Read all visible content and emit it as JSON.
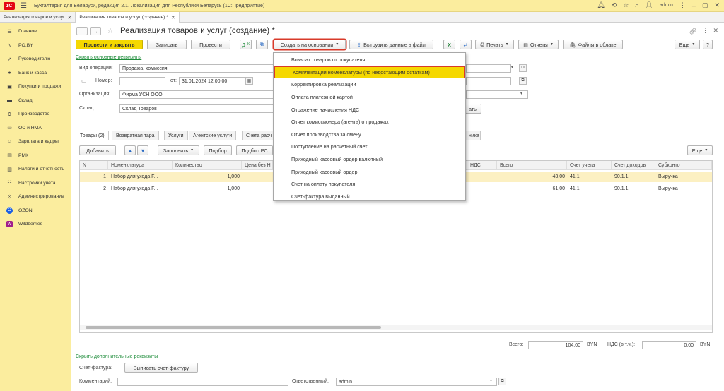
{
  "app": {
    "logo": "1С",
    "title": "Бухгалтерия для Беларуси, редакция 2.1. Локализация для Республики Беларусь   (1С:Предприятие)",
    "user": "admin",
    "accent": "#fbed9e",
    "primary_button_color": "#f5d800",
    "highlight_color": "#d83a2a"
  },
  "tabs": [
    {
      "label": "Реализация товаров и услуг",
      "active": false
    },
    {
      "label": "Реализация товаров и услуг (создание) *",
      "active": true
    }
  ],
  "sidebar": {
    "items": [
      {
        "label": "Главное",
        "icon": "menu-icon"
      },
      {
        "label": "PO.BY",
        "icon": "tilde-icon"
      },
      {
        "label": "Руководителю",
        "icon": "chart-icon"
      },
      {
        "label": "Банк и касса",
        "icon": "bank-icon"
      },
      {
        "label": "Покупки и продажи",
        "icon": "cart-icon"
      },
      {
        "label": "Склад",
        "icon": "warehouse-icon"
      },
      {
        "label": "Производство",
        "icon": "factory-icon"
      },
      {
        "label": "ОС и НМА",
        "icon": "assets-icon"
      },
      {
        "label": "Зарплата и кадры",
        "icon": "people-icon"
      },
      {
        "label": "РМК",
        "icon": "register-icon"
      },
      {
        "label": "Налоги и отчетность",
        "icon": "tax-icon"
      },
      {
        "label": "Настройки учета",
        "icon": "settings-icon"
      },
      {
        "label": "Администрирование",
        "icon": "gear-icon"
      },
      {
        "label": "OZON",
        "icon": "ozon-icon"
      },
      {
        "label": "Wildberries",
        "icon": "wildberries-icon"
      }
    ]
  },
  "document": {
    "title": "Реализация товаров и услуг (создание) *"
  },
  "toolbar": {
    "post_close": "Провести и закрыть",
    "save": "Записать",
    "post": "Провести",
    "create_based": "Создать на основании",
    "export": "Выгрузить данные в файл",
    "print": "Печать",
    "reports": "Отчеты",
    "cloud_files": "Файлы в облаке",
    "more": "Еще"
  },
  "form": {
    "hide_link": "Скрыть основные реквизиты",
    "operation_label": "Вид операции:",
    "operation_value": "Продажа, комиссия",
    "number_label": "Номер:",
    "number_value": "",
    "date_label": "от:",
    "date_value": "31.01.2024 12:00:00",
    "org_label": "Организация:",
    "org_value": "Фирма УСН ООО",
    "warehouse_label": "Склад:",
    "warehouse_value": "Склад Товаров",
    "hidden_button_tail": "ать"
  },
  "form_tabs": [
    {
      "label": "Товары (2)",
      "active": true
    },
    {
      "label": "Возвратная тара",
      "active": false
    },
    {
      "label": "Услуги",
      "active": false
    },
    {
      "label": "Агентские услуги",
      "active": false
    },
    {
      "label": "Счета расч",
      "active": false
    },
    {
      "label": "ника",
      "active": false
    }
  ],
  "grid_toolbar": {
    "add": "Добавить",
    "fill": "Заполнить",
    "select": "Подбор",
    "select_rs": "Подбор РС",
    "more": "Еще"
  },
  "grid": {
    "columns": [
      "N",
      "Номенклатура",
      "Количество",
      "Цена без Н",
      "НДС",
      "Всего",
      "Счет учета",
      "Счет доходов",
      "Субконто"
    ],
    "rows": [
      {
        "n": "1",
        "item": "Набор для ухода F...",
        "qty": "1,000",
        "total": "43,00",
        "account": "41.1",
        "income": "90.1.1",
        "subconto": "Выручка"
      },
      {
        "n": "2",
        "item": "Набор для ухода F...",
        "qty": "1,000",
        "total": "61,00",
        "account": "41.1",
        "income": "90.1.1",
        "subconto": "Выручка"
      }
    ]
  },
  "menu": {
    "items": [
      "Возврат товаров от покупателя",
      "Комплектации номенклатуры (по недостающим остаткам)",
      "Корректировка реализации",
      "Оплата платежной картой",
      "Отражение начисления НДС",
      "Отчет комиссионера (агента) о продажах",
      "Отчет производства за смену",
      "Поступление на расчетный счет",
      "Приходный кассовый ордер валютный",
      "Приходный кассовый ордер",
      "Счет на оплату покупателя",
      "Счет-фактура выданный"
    ],
    "highlighted_index": 1
  },
  "footer": {
    "total_label": "Всего:",
    "total_value": "104,00",
    "currency": "BYN",
    "vat_label": "НДС (в т.ч.):",
    "vat_value": "0,00",
    "vat_currency": "BYN",
    "extra_link": "Скрыть дополнительные реквизиты",
    "invoice_label": "Счет-фактура:",
    "invoice_button": "Выписать счет-фактуру",
    "comment_label": "Комментарий:",
    "comment_value": "",
    "responsible_label": "Ответственный:",
    "responsible_value": "admin"
  }
}
